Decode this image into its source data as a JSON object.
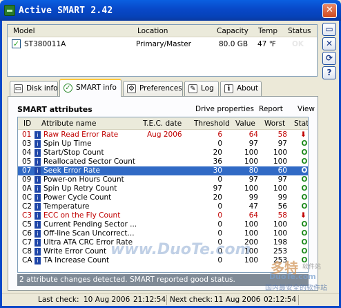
{
  "window": {
    "title": "Active SMART 2.42",
    "close_glyph": "✕"
  },
  "drive_table": {
    "headers": {
      "model": "Model",
      "location": "Location",
      "capacity": "Capacity",
      "temp": "Temp",
      "status": "Status"
    },
    "row": {
      "checked": "✓",
      "model": "ST380011A",
      "location": "Primary/Master",
      "capacity": "80.0 GB",
      "temp": "47 ℉",
      "status": "OK"
    }
  },
  "side_buttons": {
    "minimize": "▭",
    "close": "✕",
    "refresh": "⟳",
    "help": "?"
  },
  "tabs": [
    {
      "label": "Disk info",
      "icon": "▭"
    },
    {
      "label": "SMART info",
      "icon": "✓"
    },
    {
      "label": "Preferences",
      "icon": "⚙"
    },
    {
      "label": "Log",
      "icon": "✎"
    },
    {
      "label": "About",
      "icon": "ℹ"
    }
  ],
  "panel": {
    "title": "SMART attributes",
    "links": {
      "drive_properties": "Drive properties",
      "report": "Report",
      "view": "View"
    }
  },
  "attributes": {
    "headers": {
      "id": "ID",
      "name": "Attribute name",
      "tec": "T.E.C. date",
      "threshold": "Threshold",
      "value": "Value",
      "worst": "Worst",
      "status": "Status"
    },
    "rows": [
      {
        "id": "01",
        "name": "Raw Read Error Rate",
        "tec": "Aug 2006",
        "threshold": "6",
        "value": "64",
        "worst": "58",
        "status": "⬇ 1"
      },
      {
        "id": "03",
        "name": "Spin Up Time",
        "tec": "",
        "threshold": "0",
        "value": "97",
        "worst": "97",
        "status": "OK"
      },
      {
        "id": "04",
        "name": "Start/Stop Count",
        "tec": "",
        "threshold": "20",
        "value": "100",
        "worst": "100",
        "status": "OK"
      },
      {
        "id": "05",
        "name": "Reallocated Sector Count",
        "tec": "",
        "threshold": "36",
        "value": "100",
        "worst": "100",
        "status": "OK"
      },
      {
        "id": "07",
        "name": "Seek Error Rate",
        "tec": "",
        "threshold": "30",
        "value": "80",
        "worst": "60",
        "status": "OK"
      },
      {
        "id": "09",
        "name": "Power-on Hours Count",
        "tec": "",
        "threshold": "0",
        "value": "97",
        "worst": "97",
        "status": "OK"
      },
      {
        "id": "0A",
        "name": "Spin Up Retry Count",
        "tec": "",
        "threshold": "97",
        "value": "100",
        "worst": "100",
        "status": "OK"
      },
      {
        "id": "0C",
        "name": "Power Cycle Count",
        "tec": "",
        "threshold": "20",
        "value": "99",
        "worst": "99",
        "status": "OK"
      },
      {
        "id": "C2",
        "name": "Temperature",
        "tec": "",
        "threshold": "0",
        "value": "47",
        "worst": "56",
        "status": "OK"
      },
      {
        "id": "C3",
        "name": "ECC on the Fly Count",
        "tec": "",
        "threshold": "0",
        "value": "64",
        "worst": "58",
        "status": "⬇ 1"
      },
      {
        "id": "C5",
        "name": "Current Pending Sector ...",
        "tec": "",
        "threshold": "0",
        "value": "100",
        "worst": "100",
        "status": "OK"
      },
      {
        "id": "C6",
        "name": "Off-line Scan Uncorrect...",
        "tec": "",
        "threshold": "0",
        "value": "100",
        "worst": "100",
        "status": "OK"
      },
      {
        "id": "C7",
        "name": "Ultra ATA CRC Error Rate",
        "tec": "",
        "threshold": "0",
        "value": "200",
        "worst": "198",
        "status": "OK"
      },
      {
        "id": "C8",
        "name": "Write Error Count",
        "tec": "",
        "threshold": "0",
        "value": "100",
        "worst": "253",
        "status": "OK"
      },
      {
        "id": "CA",
        "name": "TA Increase Count",
        "tec": "",
        "threshold": "0",
        "value": "100",
        "worst": "253",
        "status": "OK"
      }
    ],
    "status_message": "2 attribute changes detected. SMART reported good status."
  },
  "statusbar": {
    "last_check_label": "Last check:",
    "last_check_date": "10 Aug 2006",
    "last_check_time": "21:12:54",
    "next_check_label": "Next check:",
    "next_check_date": "11 Aug 2006",
    "next_check_time": "02:12:54"
  },
  "watermarks": {
    "center": "www.DuoTe.com",
    "logo_big": "多特",
    "logo_small": "软件站",
    "logo_site": "DuoTe.com",
    "logo_slogan": "国内最安全的软件站"
  }
}
